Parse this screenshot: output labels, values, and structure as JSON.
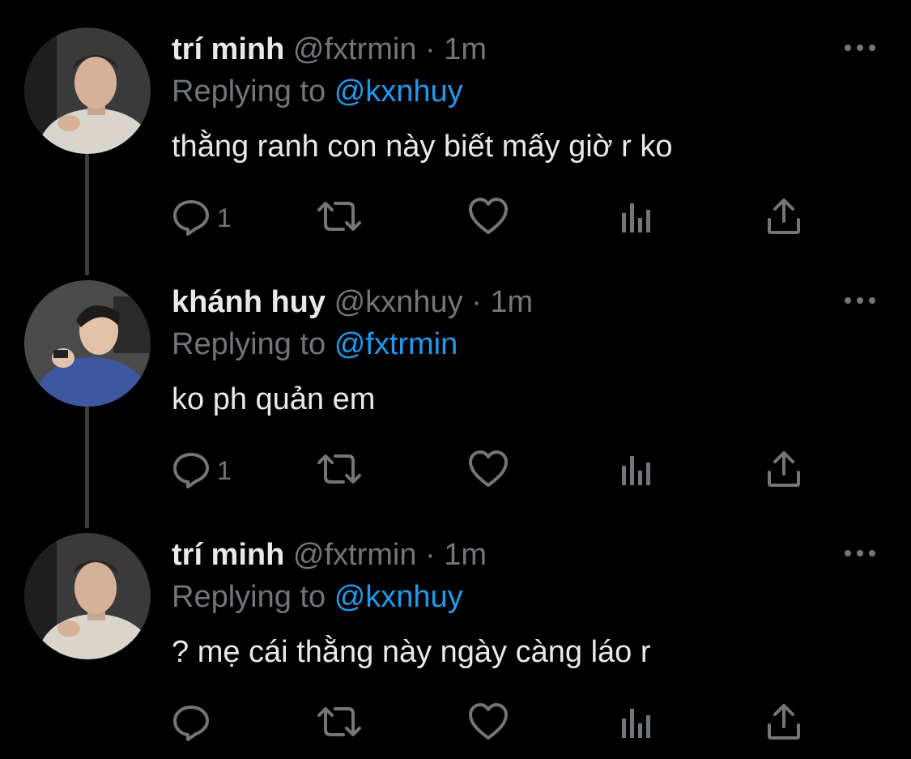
{
  "colors": {
    "background": "#000000",
    "text": "#e7e9ea",
    "muted": "#71767b",
    "accent": "#1d9bf0",
    "thread_line": "#3a3d41"
  },
  "reply_prefix": "Replying to",
  "tweets": [
    {
      "name": "trí minh",
      "handle": "@fxtrmin",
      "separator": "·",
      "time": "1m",
      "reply_to": "@kxnhuy",
      "text": "thằng ranh con này biết mấy giờ r ko",
      "reply_count": "1",
      "avatar": "photo-of-person-light-shirt"
    },
    {
      "name": "khánh huy",
      "handle": "@kxnhuy",
      "separator": "·",
      "time": "1m",
      "reply_to": "@fxtrmin",
      "text": "ko ph quản em",
      "reply_count": "1",
      "avatar": "photo-of-person-blue-shirt"
    },
    {
      "name": "trí minh",
      "handle": "@fxtrmin",
      "separator": "·",
      "time": "1m",
      "reply_to": "@kxnhuy",
      "text": "? mẹ cái thằng này ngày càng láo r",
      "reply_count": "",
      "avatar": "photo-of-person-light-shirt"
    }
  ],
  "icons": {
    "reply": "reply-icon",
    "retweet": "retweet-icon",
    "like": "heart-icon",
    "views": "views-icon",
    "share": "share-icon",
    "more": "more-icon"
  }
}
